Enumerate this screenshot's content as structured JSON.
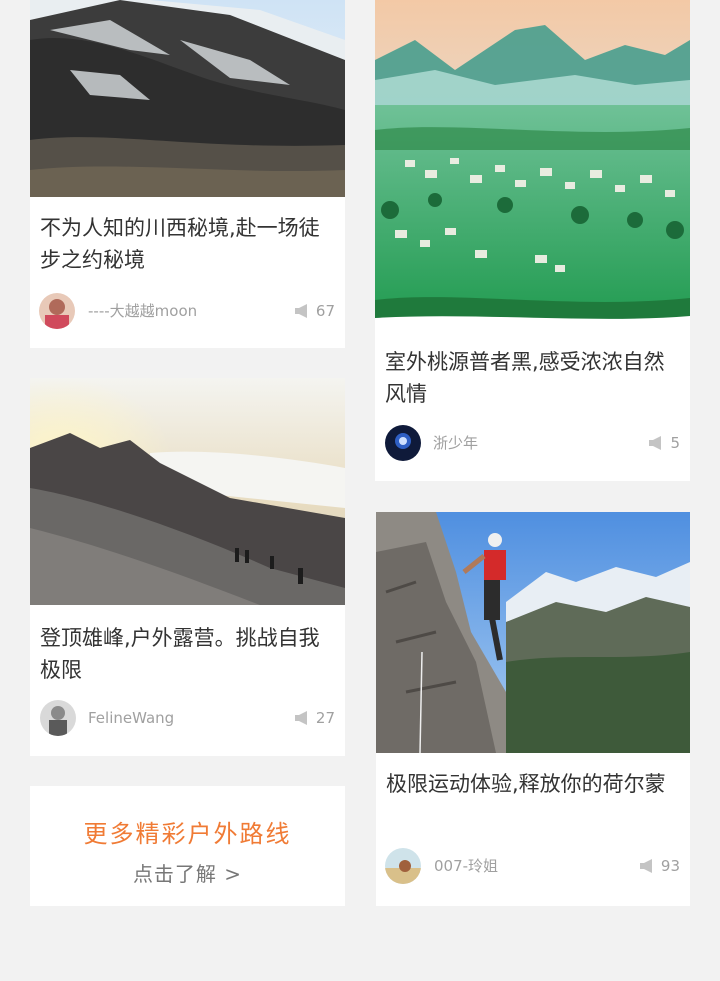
{
  "cards": [
    {
      "title": "不为人知的川西秘境,赴一场徒步之约秘境",
      "author": "----大越越moon",
      "count": "67",
      "image": "snow-mountain-photo"
    },
    {
      "title": "室外桃源普者黑,感受浓浓自然风情",
      "author": "浙少年",
      "count": "5",
      "image": "green-valley-village-photo"
    },
    {
      "title": "登顶雄峰,户外露营。挑战自我极限",
      "author": "FelineWang",
      "count": "27",
      "image": "summit-sunrise-photo"
    },
    {
      "title": "极限运动体验,释放你的荷尔蒙",
      "author": "007-玲姐",
      "count": "93",
      "image": "rock-climber-photo"
    }
  ],
  "more": {
    "title": "更多精彩户外路线",
    "link": "点击了解 >"
  },
  "colors": {
    "accent": "#f07b35",
    "text": "#333333",
    "muted": "#a0a0a0",
    "background": "#f2f2f2"
  }
}
